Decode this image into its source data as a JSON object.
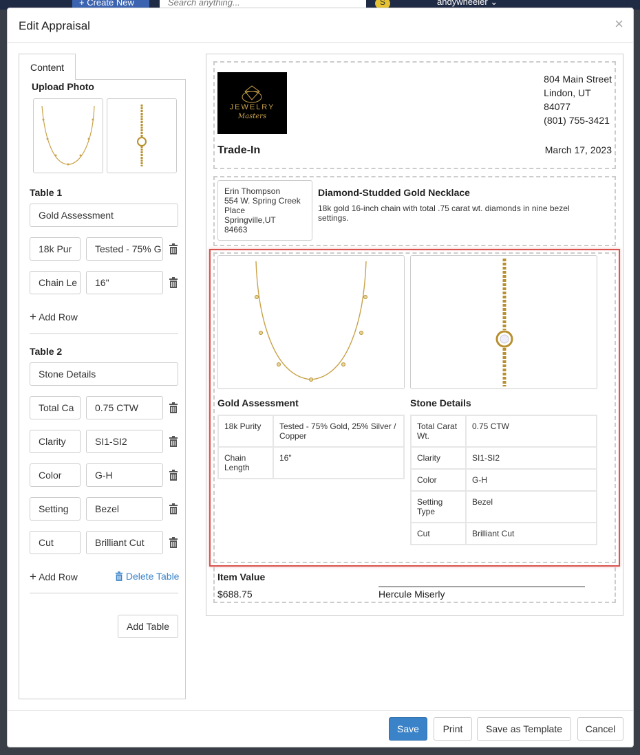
{
  "background": {
    "create_new": "+ Create New",
    "search_placeholder": "Search anything...",
    "badge": "S",
    "username": "andywheeler ⌄"
  },
  "modal": {
    "title": "Edit Appraisal",
    "close_label": "×"
  },
  "tabs": [
    {
      "label": "Content"
    }
  ],
  "content": {
    "upload_photo_label": "Upload Photo",
    "table1": {
      "label": "Table 1",
      "name": "Gold Assessment",
      "rows": [
        {
          "key": "18k Pur",
          "value": "Tested - 75% G"
        },
        {
          "key": "Chain Le",
          "value": "16\""
        }
      ]
    },
    "table2": {
      "label": "Table 2",
      "name": "Stone Details",
      "rows": [
        {
          "key": "Total Ca",
          "value": "0.75 CTW"
        },
        {
          "key": "Clarity",
          "value": "SI1-SI2"
        },
        {
          "key": "Color",
          "value": "G-H"
        },
        {
          "key": "Setting",
          "value": "Bezel"
        },
        {
          "key": "Cut",
          "value": "Brilliant Cut"
        }
      ]
    },
    "add_row_label": "Add Row",
    "add_row_symbol": "+",
    "delete_table_label": "Delete Table",
    "add_table_label": "Add Table"
  },
  "preview": {
    "logo": {
      "line1": "JEWELRY",
      "line2": "Masters"
    },
    "address": [
      "804 Main Street",
      "Lindon, UT",
      "84077",
      "(801) 755-3421"
    ],
    "doc_title": "Trade-In",
    "date": "March 17, 2023",
    "customer": [
      "Erin Thompson",
      "554 W. Spring Creek",
      "Place",
      "Springville,UT",
      "84663"
    ],
    "item_title": "Diamond-Studded Gold Necklace",
    "item_description": "18k gold 16-inch chain with total .75 carat wt. diamonds in nine bezel settings.",
    "table1": {
      "title": "Gold Assessment",
      "rows": [
        {
          "key": "18k Purity",
          "value": "Tested - 75% Gold, 25% Silver / Copper"
        },
        {
          "key": "Chain Length",
          "value": "16\""
        }
      ]
    },
    "table2": {
      "title": "Stone Details",
      "rows": [
        {
          "key": "Total Carat Wt.",
          "value": "0.75 CTW"
        },
        {
          "key": "Clarity",
          "value": "SI1-SI2"
        },
        {
          "key": "Color",
          "value": "G-H"
        },
        {
          "key": "Setting Type",
          "value": "Bezel"
        },
        {
          "key": "Cut",
          "value": "Brilliant Cut"
        }
      ]
    },
    "item_value_label": "Item Value",
    "item_value": "$688.75",
    "signature_name": "Hercule Miserly"
  },
  "footer": {
    "save": "Save",
    "print": "Print",
    "save_template": "Save as Template",
    "cancel": "Cancel"
  },
  "colors": {
    "primary": "#3a83c8",
    "highlight": "#d9534f",
    "gold": "#c9a24a"
  }
}
